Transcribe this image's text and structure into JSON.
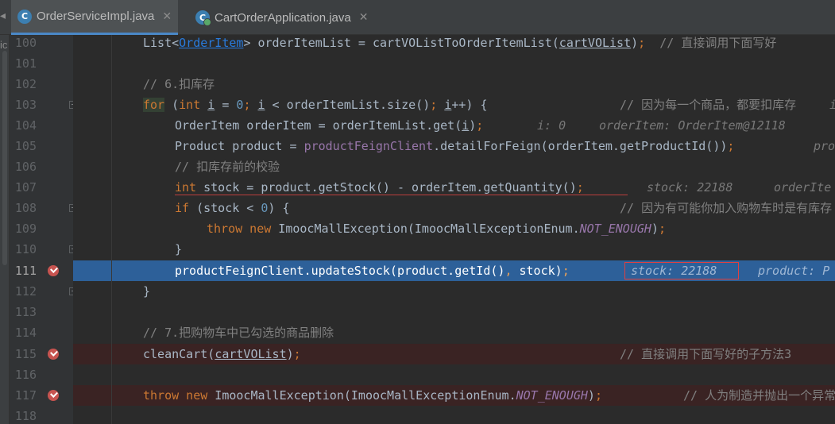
{
  "tabs": [
    {
      "name": "OrderServiceImpl.java",
      "icon": "C",
      "active": true
    },
    {
      "name": "CartOrderApplication.java",
      "icon": "C",
      "active": false
    }
  ],
  "left_strip": {
    "label": "ic"
  },
  "lines": [
    {
      "n": "100",
      "code": "List<OrderItem> orderItemList = cartVOListToOrderItemList(cartVOList);  // 直接调用下面写好"
    },
    {
      "n": "101"
    },
    {
      "n": "102",
      "code": "// 6.扣库存"
    },
    {
      "n": "103",
      "code": "for (int i = 0; i < orderItemList.size(); i++) {",
      "comment": "// 因为每一个商品，都要扣库存",
      "hint": "i"
    },
    {
      "n": "104",
      "code": "OrderItem orderItem = orderItemList.get(i);",
      "hint1": "i: 0",
      "hint2": "orderItem: OrderItem@12118"
    },
    {
      "n": "105",
      "code": "Product product = productFeignClient.detailForFeign(orderItem.getProductId());",
      "hint": "pro"
    },
    {
      "n": "106",
      "code": "// 扣库存前的校验"
    },
    {
      "n": "107",
      "code": "int stock = product.getStock() - orderItem.getQuantity();",
      "hint1": "stock: 22188",
      "hint2": "orderIte"
    },
    {
      "n": "108",
      "code": "if (stock < 0) {",
      "comment": "// 因为有可能你加入购物车时是有库存"
    },
    {
      "n": "109",
      "code": "throw new ImoocMallException(ImoocMallExceptionEnum.NOT_ENOUGH);"
    },
    {
      "n": "110",
      "code": "}"
    },
    {
      "n": "111",
      "code": "productFeignClient.updateStock(product.getId(), stock);",
      "hint1": "stock: 22188",
      "hint2": "product: P"
    },
    {
      "n": "112",
      "code": "}"
    },
    {
      "n": "113"
    },
    {
      "n": "114",
      "code": "// 7.把购物车中已勾选的商品删除"
    },
    {
      "n": "115",
      "code": "cleanCart(cartVOList);",
      "comment": "// 直接调用下面写好的子方法3"
    },
    {
      "n": "116"
    },
    {
      "n": "117",
      "code": "throw new ImoocMallException(ImoocMallExceptionEnum.NOT_ENOUGH);",
      "comment": "// 人为制造并抛出一个异常"
    },
    {
      "n": "118"
    }
  ],
  "colors": {
    "background": "#2b2b2b",
    "execution_line": "#2d6099",
    "breakpoint_line": "#3a2323",
    "breakpoint": "#c75450",
    "keyword": "#cc7832",
    "number": "#6897bb",
    "comment": "#808080",
    "field": "#9876aa"
  },
  "icons": [
    "class-icon",
    "close-icon",
    "breakpoint-icon",
    "fold-icon",
    "scroll-left-icon"
  ]
}
